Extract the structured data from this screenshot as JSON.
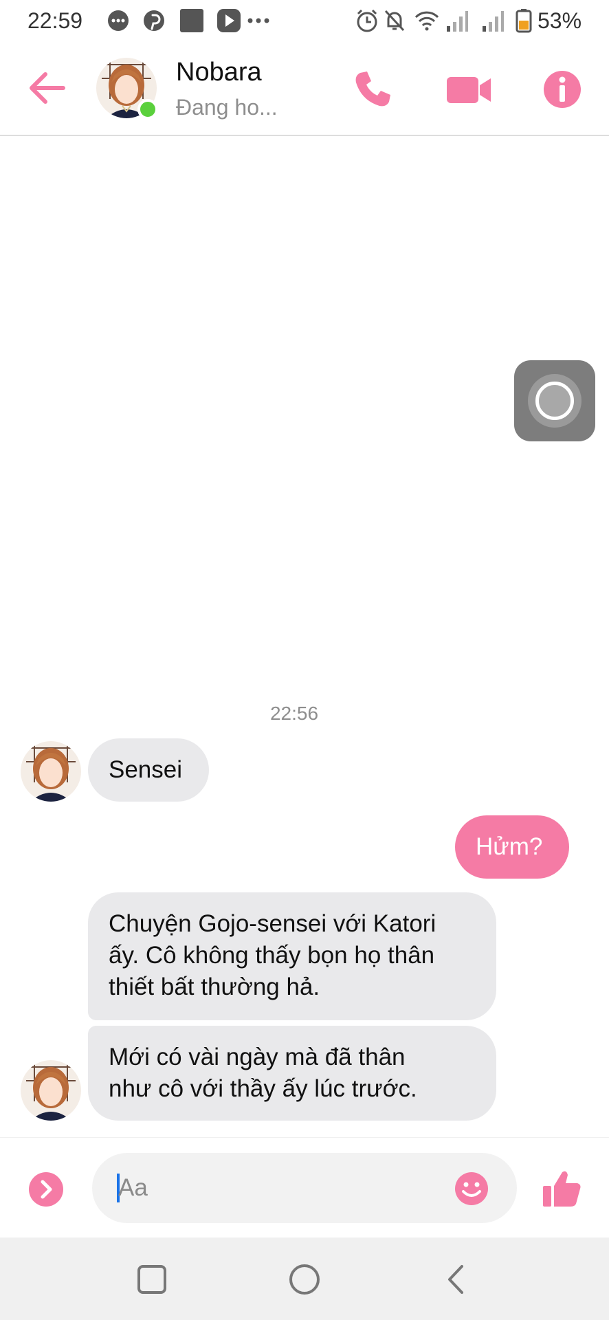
{
  "status_bar": {
    "time": "22:59",
    "battery": "53%"
  },
  "header": {
    "contact_name": "Nobara",
    "contact_status": "Đang ho...",
    "accent_color": "#f57ba5",
    "online_color": "#5ad03c"
  },
  "chat": {
    "timestamp": "22:56",
    "messages": [
      {
        "sender": "contact",
        "text": "Sensei"
      },
      {
        "sender": "me",
        "text": "Hửm?"
      },
      {
        "sender": "contact",
        "lines": [
          "Chuyện Gojo-sensei với Katori",
          "ấy. Cô không thấy bọn họ thân",
          "thiết bất thường hả."
        ]
      },
      {
        "sender": "contact",
        "lines": [
          "Mới có vài ngày mà đã thân",
          "như cô với thầy ấy lúc trước."
        ]
      }
    ],
    "incoming_bubble_color": "#e9e9eb",
    "outgoing_bubble_color": "#f57ba5"
  },
  "composer": {
    "placeholder": "Aa"
  },
  "icons": {
    "status": [
      "messenger-icon",
      "pinterest-icon",
      "app-square-icon",
      "play-icon",
      "more-dots-icon",
      "alarm-icon",
      "notifications-off-icon",
      "wifi-icon",
      "signal-icon",
      "signal-icon",
      "battery-icon"
    ],
    "header": [
      "back-arrow-icon",
      "phone-icon",
      "video-camera-icon",
      "info-icon"
    ],
    "composer": [
      "chevron-right-icon",
      "emoji-icon",
      "thumbs-up-icon"
    ],
    "nav": [
      "recent-apps-icon",
      "home-icon",
      "back-icon"
    ]
  }
}
